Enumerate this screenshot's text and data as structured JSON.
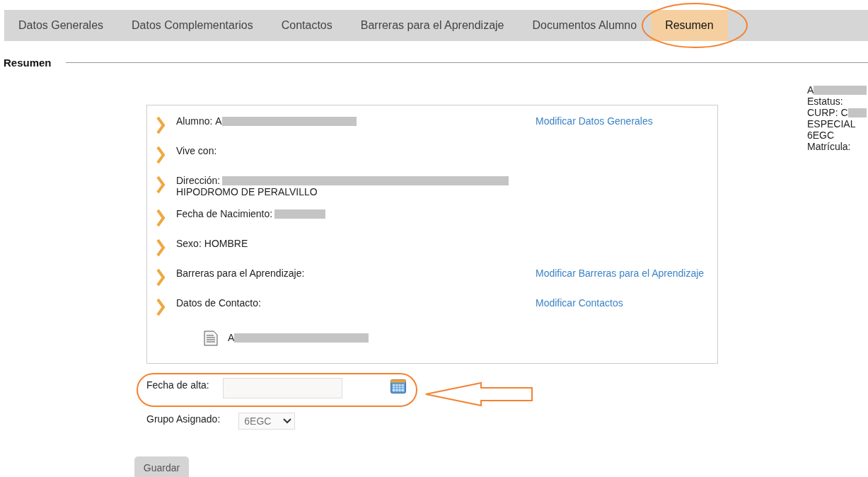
{
  "tabs": [
    {
      "label": "Datos Generales",
      "selected": false
    },
    {
      "label": "Datos Complementarios",
      "selected": false
    },
    {
      "label": "Contactos",
      "selected": false
    },
    {
      "label": "Barreras para el Aprendizaje",
      "selected": false
    },
    {
      "label": "Documentos Alumno",
      "selected": false
    },
    {
      "label": "Resumen",
      "selected": true
    }
  ],
  "section_title": "Resumen",
  "side_info": [
    {
      "text": "A",
      "redacted": true
    },
    {
      "text": "Estatus:",
      "redacted": false
    },
    {
      "text": "CURP: C",
      "redacted": true
    },
    {
      "text": "ESPECIAL",
      "redacted": false
    },
    {
      "text": "6EGC",
      "redacted": false
    },
    {
      "text": "Matrícula:",
      "redacted": false
    }
  ],
  "details": [
    {
      "label": "Alumno:",
      "value": "A",
      "redacted": true,
      "link": "Modificar Datos Generales"
    },
    {
      "label": "Vive con:",
      "redacted": false
    },
    {
      "label": "Dirección:",
      "redacted": true,
      "second_line": "HIPODROMO DE PERALVILLO"
    },
    {
      "label": "Fecha de Nacimiento:",
      "redacted": true
    },
    {
      "label": "Sexo:",
      "value": "HOMBRE",
      "redacted": false
    },
    {
      "label": "Barreras para el Aprendizaje:",
      "redacted": false,
      "link": "Modificar Barreras para el Aprendizaje"
    },
    {
      "label": "Datos de Contacto:",
      "redacted": false,
      "link": "Modificar Contactos"
    }
  ],
  "contacts": [
    {
      "text": "A",
      "redacted": true
    }
  ],
  "form": {
    "fecha_de_alta": {
      "label": "Fecha de alta:"
    },
    "grupo_asignado": {
      "label": "Grupo Asignado:",
      "value": "6EGC"
    },
    "save_button": {
      "label": "Guardar",
      "disabled": true
    }
  }
}
